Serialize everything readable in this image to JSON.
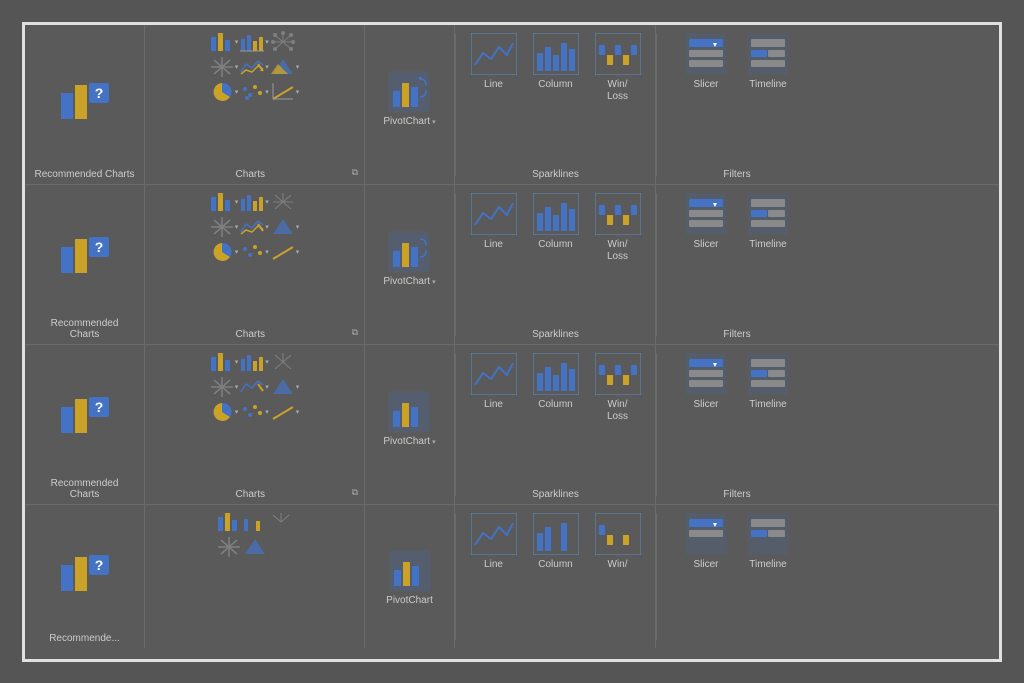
{
  "ribbon": {
    "rows": [
      {
        "sections": [
          {
            "id": "recommended",
            "label": "Recommended Charts",
            "type": "recommended"
          },
          {
            "id": "charts",
            "label": "Charts",
            "type": "charts"
          },
          {
            "id": "pivot",
            "label": "PivotChart",
            "type": "pivot"
          },
          {
            "id": "sparklines",
            "label": "Sparklines",
            "type": "sparklines"
          },
          {
            "id": "filters",
            "label": "Filters",
            "type": "filters"
          }
        ]
      }
    ],
    "labels": {
      "recommended": "Recommended\nCharts",
      "charts": "Charts",
      "pivotChart": "PivotChart",
      "line": "Line",
      "column": "Column",
      "winLoss": "Win/\nLoss",
      "slicer": "Slicer",
      "timeline": "Timeline",
      "sparklines": "Sparklines",
      "filters": "Filters"
    }
  }
}
